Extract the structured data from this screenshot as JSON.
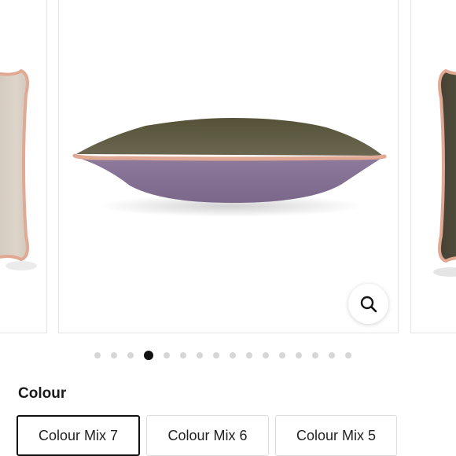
{
  "gallery": {
    "active_slide_index": 3,
    "slide_count": 16,
    "colors": {
      "left_cushion": "#d9d1c6",
      "main_top": "#5e5a42",
      "main_bottom": "#8a7698",
      "piping": "#e1a894",
      "right_cushion": "#4d4a3a"
    },
    "zoom_icon": "magnifier-icon"
  },
  "colour": {
    "label": "Colour",
    "options": [
      {
        "label": "Colour Mix 7",
        "selected": true
      },
      {
        "label": "Colour Mix 6",
        "selected": false
      },
      {
        "label": "Colour Mix 5",
        "selected": false
      }
    ]
  }
}
